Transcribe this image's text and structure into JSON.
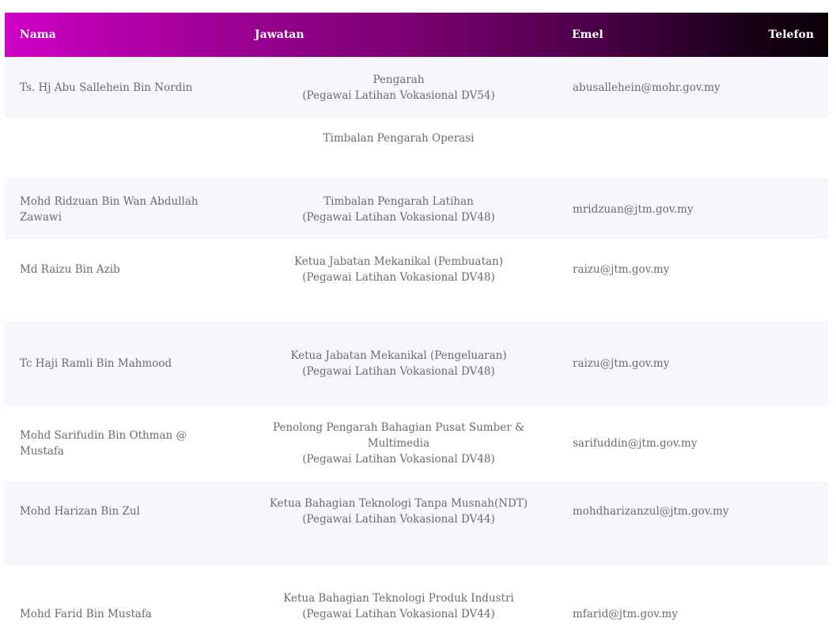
{
  "table": {
    "headers": {
      "name": "Nama",
      "role": "Jawatan",
      "email": "Emel",
      "phone": "Telefon"
    },
    "rows": [
      {
        "name": "Ts. Hj Abu Sallehein Bin Nordin",
        "role_line1": "Pengarah",
        "role_line2": "(Pegawai Latihan Vokasional DV54)",
        "email": "abusallehein@mohr.gov.my",
        "phone": ""
      },
      {
        "name": "",
        "role_line1": "Timbalan Pengarah Operasi",
        "role_line2": "",
        "email": "",
        "phone": ""
      },
      {
        "name": "Mohd Ridzuan Bin Wan Abdullah Zawawi",
        "role_line1": "Timbalan Pengarah Latihan",
        "role_line2": "(Pegawai Latihan Vokasional DV48)",
        "email": "mridzuan@jtm.gov.my",
        "phone": ""
      },
      {
        "name": "Md Raizu Bin Azib",
        "role_line1": "Ketua Jabatan Mekanikal (Pembuatan)",
        "role_line2": "(Pegawai Latihan Vokasional DV48)",
        "email": "raizu@jtm.gov.my",
        "phone": ""
      },
      {
        "name": "Tc Haji Ramli Bin Mahmood",
        "role_line1": "Ketua Jabatan Mekanikal (Pengeluaran)",
        "role_line2": "(Pegawai Latihan Vokasional DV48)",
        "email": "raizu@jtm.gov.my",
        "phone": ""
      },
      {
        "name": "Mohd Sarifudin Bin Othman @ Mustafa",
        "role_line1": "Penolong Pengarah Bahagian Pusat Sumber & Multimedia",
        "role_line2": "(Pegawai Latihan Vokasional DV48)",
        "email": "sarifuddin@jtm.gov.my",
        "phone": ""
      },
      {
        "name": "Mohd Harizan Bin Zul",
        "role_line1": "Ketua Bahagian Teknologi Tanpa Musnah(NDT)",
        "role_line2": "(Pegawai Latihan Vokasional DV44)",
        "email": "mohdharizanzul@jtm.gov.my",
        "phone": ""
      },
      {
        "name": "Mohd Farid Bin Mustafa",
        "role_line1": "Ketua Bahagian Teknologi Produk Industri",
        "role_line2": "(Pegawai Latihan Vokasional DV44)",
        "email": "mfarid@jtm.gov.my",
        "phone": ""
      }
    ]
  },
  "colors": {
    "header_gradient_start": "#d000c6",
    "header_gradient_end": "#0a0008",
    "row_alt_bg": "#f7f6fd",
    "text": "#6b6b6b"
  }
}
